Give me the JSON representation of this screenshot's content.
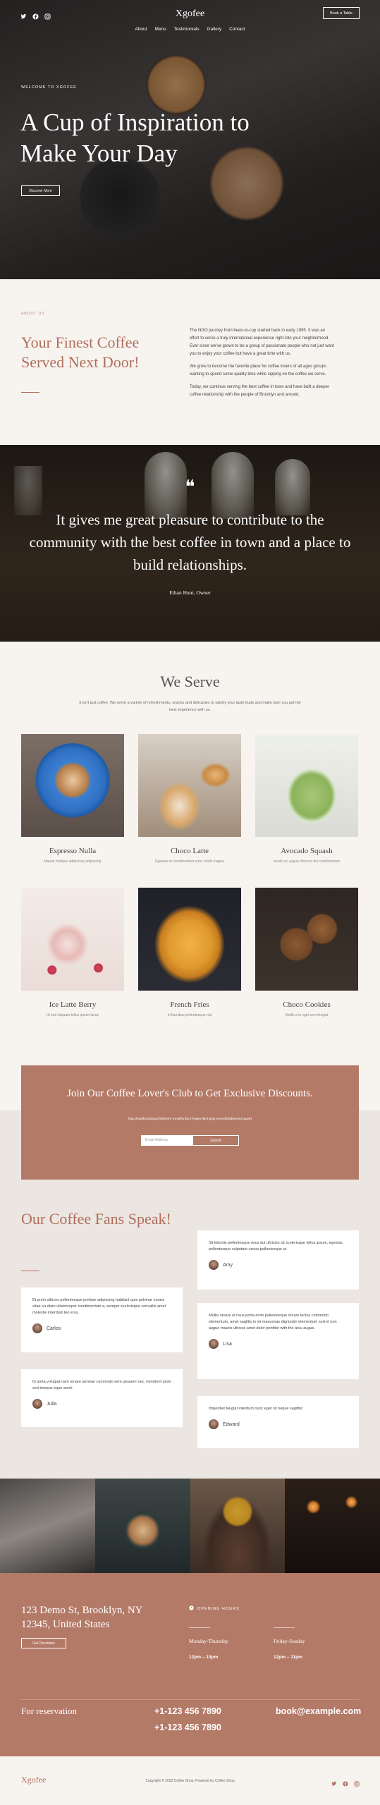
{
  "header": {
    "logo": "Xgofee",
    "nav": [
      "About",
      "Menu",
      "Testimonials",
      "Gallery",
      "Contact"
    ],
    "book_button": "Book a Table",
    "social_icons": [
      "twitter-icon",
      "facebook-icon",
      "instagram-icon"
    ]
  },
  "hero": {
    "kicker": "WELCOME TO XGOFEE",
    "title": "A Cup of Inspiration to Make Your Day",
    "button": "Discover More"
  },
  "about": {
    "kicker": "ABOUT US",
    "title": "Your Finest Coffee Served Next Door!",
    "paragraphs": [
      "The NGO journey from bean-to-cup started back in early 1995. It was an effort to serve a truly international experience right into your neighborhood. Ever since we've grown to be a group of passionate people who not just want you to enjoy your coffee but have a great time with us.",
      "We grow to become the favorite place for coffee lovers of all ages groups wanting to spend some quality time while sipping on the coffee we serve.",
      "Today, we continue serving the best coffee in town and have built a deeper coffee relationship with the people of Brooklyn and around."
    ]
  },
  "quote": {
    "mark": "❝",
    "text": "It gives me great pleasure to contribute to the community with the best coffee in town and a place to build relationships.",
    "author": "Ethan Hunt, Owner"
  },
  "serve": {
    "title": "We Serve",
    "subtitle": "It isn't just coffee. We serve a variety of refreshments, snacks and delicacies to satisfy your taste buds and make sure you get the best experience with us.",
    "items": [
      {
        "name": "Espresso Nulla",
        "desc": "Mauris tristique adipiscing adipiscing"
      },
      {
        "name": "Choco Latte",
        "desc": "Egestas et condimentum nunc morbi magna"
      },
      {
        "name": "Avocado Squash",
        "desc": "Iaculis ac augue rhoncus dui condimentum"
      },
      {
        "name": "Ice Latte Berry",
        "desc": "Ut sed aliquam tellus ipsum lacus"
      },
      {
        "name": "French Fries",
        "desc": "In faucibus pellentesque nisl"
      },
      {
        "name": "Choco Cookies",
        "desc": "Mollis a in eget sem feugiat"
      }
    ]
  },
  "newsletter": {
    "title": "Join Our Coffee Lover's Club to Get Exclusive Discounts.",
    "small": "http://asdlkmanlicpm/skklnfm-mnsfiferdum-hsjwn-lkinl-qsrjj-nnsmfe/ttdbernsd-agwrl",
    "placeholder": "Email Address",
    "button": "Submit"
  },
  "testimonials": {
    "title": "Our Coffee Fans Speak!",
    "cards": [
      {
        "text": "Sit lobortis pellentesque risus dui ultricies sit scelerisque tellus ipsum, egestas pellentesque vulputate varius pellentesque ut.",
        "name": "Amy"
      },
      {
        "text": "Et proin ultrices pellentesque pretium adipiscing habitant quis pulvinar ornare vitae eu diam ullamcorper condimentum a, semper scelerisque convallis amet molestie interdum leo eros.",
        "name": "Carlos"
      },
      {
        "text": "Mollis ornare et risus porta enim pellentesque ornare lectus commodo elementum, amet sagittis in mi maecenas dignissim elementum sed et non augue mauris ultrices amet dolor porttitor with the arcu augue.",
        "name": "Lisa"
      },
      {
        "text": "Id porta volutpat nam ornare aenean commodo sem posuere nec, hendrerit proin sed tempus eque amet.",
        "name": "Julia"
      },
      {
        "text": "Imperdiet feugiat interdum nunc eget sit neque sagittis!",
        "name": "Edward"
      }
    ]
  },
  "footer": {
    "address": "123 Demo St, Brooklyn, NY 12345, United States",
    "directions_button": "Get Directions",
    "hours_label": "OPENING HOURS",
    "hours": [
      {
        "day": "Monday-Thursday",
        "time": "12pm – 10pm"
      },
      {
        "day": "Friday-Sunday",
        "time": "12pm – 11pm"
      }
    ],
    "reservation_label": "For reservation",
    "phones": [
      "+1-123 456 7890",
      "+1-123 456 7890"
    ],
    "email": "book@example.com"
  },
  "bottom": {
    "logo": "Xgofee",
    "copyright": "Copyright © 2022 Coffee Shop. Powered by Coffee Shop"
  },
  "colors": {
    "accent": "#b47a68",
    "accent_text": "#b06f5c",
    "cream": "#f7f3ef"
  }
}
